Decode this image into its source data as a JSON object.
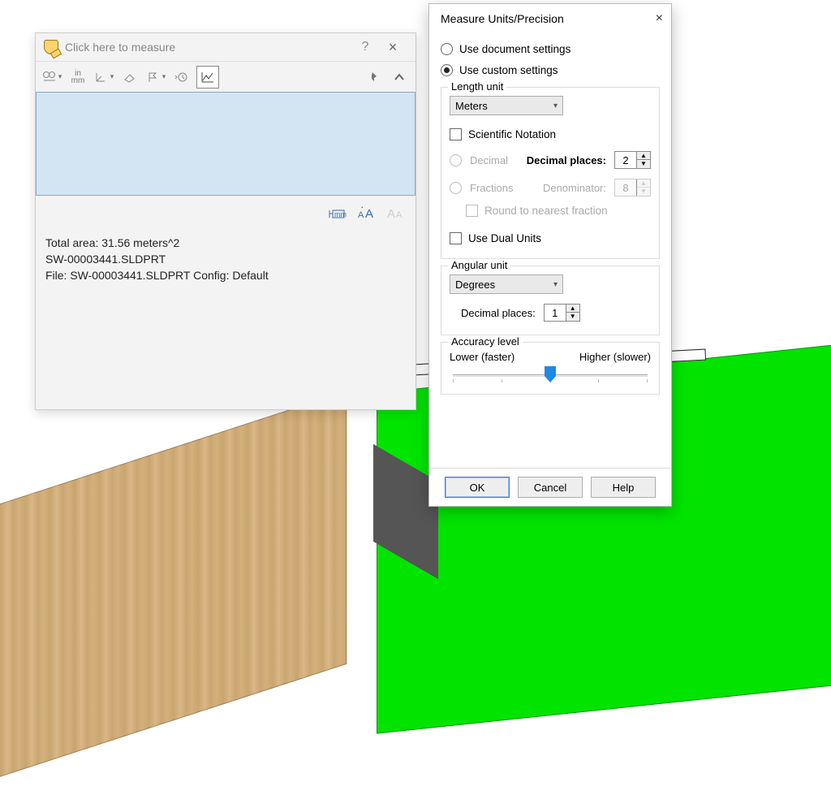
{
  "measure_window": {
    "title_placeholder": "Click here to measure",
    "help": "?",
    "close": "×",
    "toolbar": {
      "inmm_top": "in",
      "inmm_bot": "mm"
    },
    "mid_icons": {
      "first_label": "mm"
    },
    "body": {
      "line1": "Total area: 31.56 meters^2",
      "line2": "SW-00003441.SLDPRT",
      "line3": "File: SW-00003441.SLDPRT Config: Default"
    }
  },
  "dialog": {
    "title": "Measure Units/Precision",
    "close": "×",
    "radios": {
      "use_document": "Use document settings",
      "use_custom": "Use custom settings"
    },
    "length": {
      "group_label": "Length unit",
      "unit_value": "Meters",
      "scientific": "Scientific Notation",
      "decimal": "Decimal",
      "decimal_places_label": "Decimal places:",
      "decimal_places_value": "2",
      "fractions": "Fractions",
      "denominator_label": "Denominator:",
      "denominator_value": "8",
      "round": "Round to nearest fraction",
      "dual": "Use Dual Units"
    },
    "angular": {
      "group_label": "Angular unit",
      "unit_value": "Degrees",
      "decimal_places_label": "Decimal places:",
      "decimal_places_value": "1"
    },
    "accuracy": {
      "group_label": "Accuracy level",
      "lower": "Lower (faster)",
      "higher": "Higher (slower)"
    },
    "buttons": {
      "ok": "OK",
      "cancel": "Cancel",
      "help": "Help"
    }
  }
}
